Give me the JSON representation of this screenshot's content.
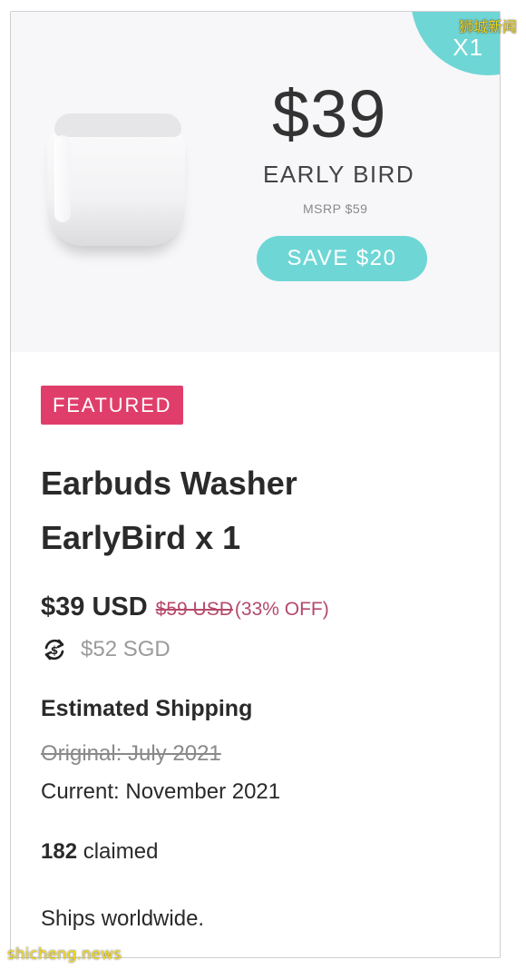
{
  "watermark": {
    "top": "狮城新闻",
    "bottom": "shicheng.news"
  },
  "hero": {
    "corner_badge": "X1",
    "price": "$39",
    "tier": "EARLY BIRD",
    "msrp": "MSRP $59",
    "save": "SAVE $20",
    "colors": {
      "accent": "#6fd6d6",
      "background": "#f7f7f9"
    }
  },
  "badge": {
    "label": "FEATURED",
    "color": "#e03e6a"
  },
  "product": {
    "title_line1": "Earbuds Washer",
    "title_line2": "EarlyBird x 1"
  },
  "pricing": {
    "price": "$39 USD",
    "original": "$59 USD ",
    "discount": "(33% OFF)",
    "converted": "$52 SGD",
    "converted_icon": "currency-exchange-icon"
  },
  "shipping": {
    "heading": "Estimated Shipping",
    "original": "Original: July 2021",
    "current": "Current: November 2021"
  },
  "claims": {
    "count": "182",
    "label": " claimed"
  },
  "ships": "Ships worldwide."
}
